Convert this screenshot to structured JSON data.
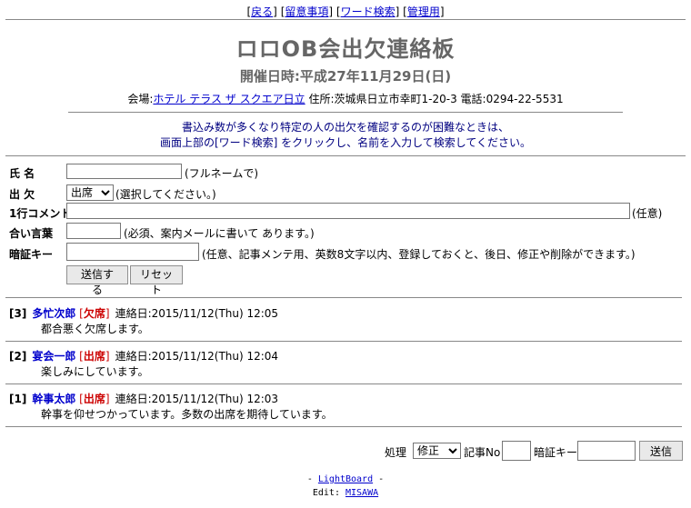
{
  "nav": {
    "items": [
      {
        "label": "戻る"
      },
      {
        "label": "留意事項"
      },
      {
        "label": "ワード検索"
      },
      {
        "label": "管理用"
      }
    ]
  },
  "header": {
    "title": "ロロOB会出欠連絡板",
    "date": "開催日時:平成27年11月29日(日)",
    "venue_prefix": "会場:",
    "venue_link": "ホテル テラス ザ スクエア日立",
    "address": "住所:茨城県日立市幸町1-20-3",
    "phone": "電話:0294-22-5531"
  },
  "notice": {
    "line1": "書込み数が多くなり特定の人の出欠を確認するのが困難なときは、",
    "line2": "画面上部の[ワード検索] をクリックし、名前を入力して検索してください。"
  },
  "form": {
    "name_label": "氏  名",
    "name_note": "(フルネームで)",
    "attend_label": "出  欠",
    "attend_selected": "出席",
    "attend_note": "(選択してください。)",
    "comment_label": "1行コメント",
    "comment_note": "(任意)",
    "password_label": "合い言葉",
    "password_note": "(必須、案内メールに書いて あります。)",
    "key_label": "暗証キー",
    "key_note": "(任意、記事メンテ用、英数8文字以内、登録しておくと、後日、修正や削除ができます。)",
    "submit_label": "送信する",
    "reset_label": "リセット"
  },
  "entries": [
    {
      "no": "[3]",
      "name": "多忙次郎",
      "status": "欠席",
      "date": "連絡日:2015/11/12(Thu) 12:05",
      "message": "都合悪く欠席します。"
    },
    {
      "no": "[2]",
      "name": "宴会一郎",
      "status": "出席",
      "date": "連絡日:2015/11/12(Thu) 12:04",
      "message": "楽しみにしています。"
    },
    {
      "no": "[1]",
      "name": "幹事太郎",
      "status": "出席",
      "date": "連絡日:2015/11/12(Thu) 12:03",
      "message": "幹事を仰せつかっています。多数の出席を期待しています。"
    }
  ],
  "process": {
    "label": "処理",
    "selected": "修正",
    "no_label": "記事No",
    "key_label": "暗証キー",
    "submit_label": "送信"
  },
  "footer": {
    "line1_prefix": "- ",
    "line1_link": "LightBoard",
    "line1_suffix": " -",
    "line2_prefix": "Edit: ",
    "line2_link": "MISAWA"
  }
}
